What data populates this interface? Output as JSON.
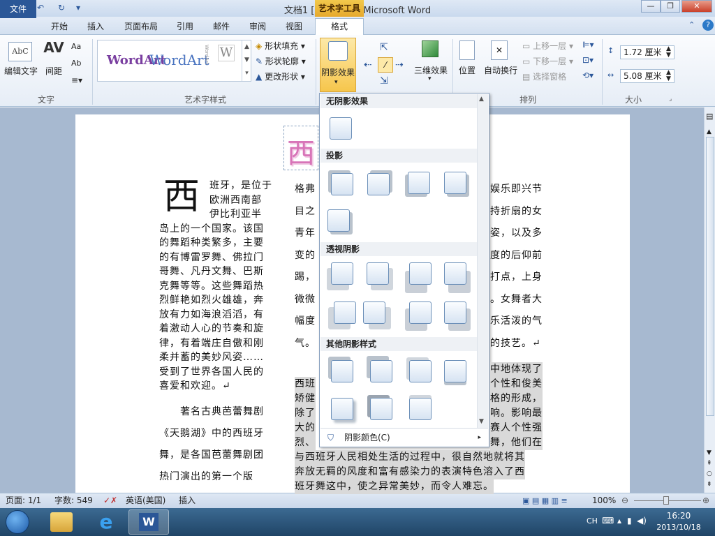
{
  "window": {
    "title": "文档1 [兼容模式] - Microsoft Word",
    "context_tab_header": "艺术字工具"
  },
  "tabs": [
    "文件",
    "开始",
    "插入",
    "页面布局",
    "引用",
    "邮件",
    "审阅",
    "视图",
    "格式"
  ],
  "ribbon": {
    "text_group": {
      "label": "文字",
      "edit_text": "编辑文字",
      "spacing": "间距"
    },
    "wordart_group": {
      "label": "艺术字样式",
      "sample1": "WordArt",
      "sample2": "WordArt",
      "shape_fill": "形状填充",
      "shape_outline": "形状轮廓",
      "change_shape": "更改形状"
    },
    "shadow_effect": "阴影效果",
    "threed_effect": "三维效果",
    "arrange_group": {
      "label": "排列",
      "position": "位置",
      "auto_wrap": "自动换行",
      "bring_forward": "上移一层",
      "send_backward": "下移一层",
      "selection_pane": "选择窗格"
    },
    "size_group": {
      "label": "大小",
      "height": "1.72 厘米",
      "width": "5.08 厘米"
    }
  },
  "shadow_menu": {
    "sections": [
      "无阴影效果",
      "投影",
      "透视阴影",
      "其他阴影样式"
    ],
    "footer": "阴影颜色(C)"
  },
  "document": {
    "wordart_char": "西",
    "drop_cap": "西",
    "left_lines": [
      "班牙，是位于",
      "欧洲西南部",
      "伊比利亚半",
      "岛上的一个国家。该国",
      "的舞蹈种类繁多，主要",
      "的有博雷罗舞、佛拉门",
      "哥舞、凡丹文舞、巴斯",
      "克舞等等。这些舞蹈热",
      "烈鲜艳如烈火雄雄，奔",
      "放有力如海浪滔滔，有",
      "着激动人心的节奏和旋",
      "律，有着端庄自傲和刚",
      "柔并蓄的美妙风姿……",
      "受到了世界各国人民的",
      "喜爱和欢迎。↵"
    ],
    "left_lines2": [
      "著名古典芭蕾舞剧",
      "《天鹅湖》中的西班牙",
      "舞，是各国芭蕾舞剧团",
      "热门演出的第一个版"
    ],
    "right_left_frag": [
      "格弗",
      "目之",
      "青年",
      "变的",
      "踢，",
      "微微",
      "幅度",
      "气。"
    ],
    "right_right_frag": [
      "娱乐即兴节",
      "持折扇的女",
      "姿，以及多",
      "度的后仰前",
      "打点，上身",
      "。女舞者大",
      "乐活泼的气",
      "的技艺。↵"
    ],
    "right_hl_left": [
      "西班",
      "矫健",
      "除了",
      "大的",
      "烈、",
      "与西班牙人民相处生活的过程中，很自然地就将其",
      "奔放无羁的风度和富有感染力的表演特色溶入了西",
      "班牙舞这中，使之异常美妙，而令人难忘。"
    ],
    "right_hl_right": [
      "中地体现了",
      "个性和俊美",
      "格的形成，",
      "响。影响最",
      "赛人个性强",
      "舞，他们在"
    ]
  },
  "status": {
    "page": "页面: 1/1",
    "words": "字数: 549",
    "lang": "英语(美国)",
    "mode": "插入",
    "zoom": "100%"
  },
  "taskbar": {
    "ime": "CH",
    "time": "16:20",
    "date": "2013/10/18"
  }
}
